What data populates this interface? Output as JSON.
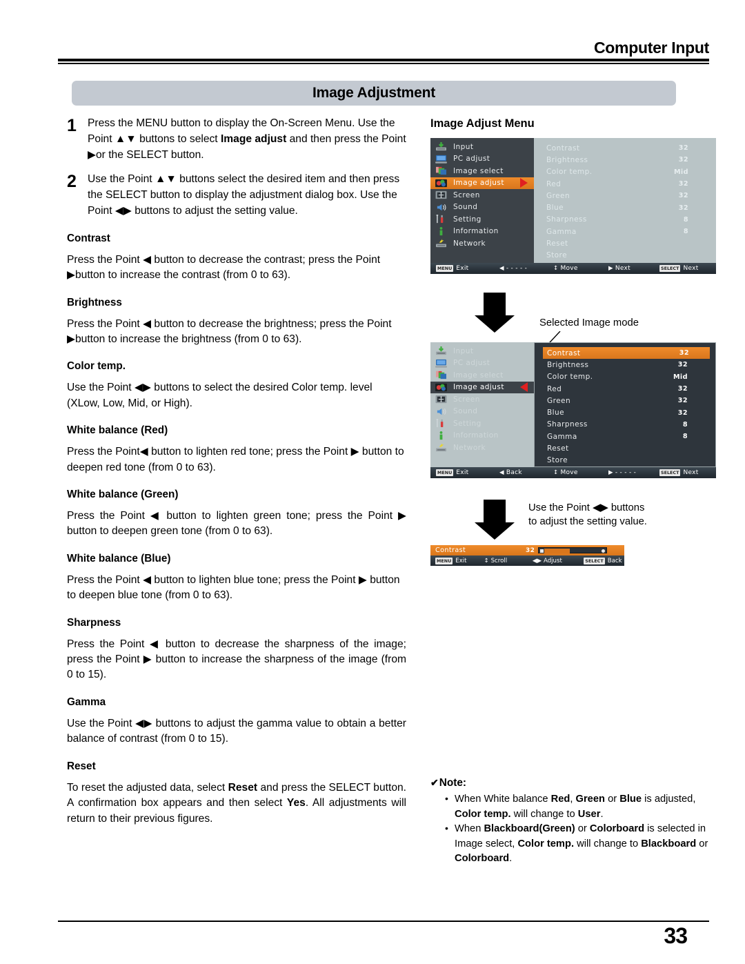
{
  "header": {
    "title": "Computer Input",
    "section": "Image Adjustment"
  },
  "steps": [
    {
      "num": "1",
      "parts": [
        {
          "t": "Press the MENU button to display the On-Screen Menu. Use the Point ▲▼ buttons to select ",
          "b": false
        },
        {
          "t": "Image adjust",
          "b": true
        },
        {
          "t": " and then press the Point ▶or the SELECT button.",
          "b": false
        }
      ]
    },
    {
      "num": "2",
      "parts": [
        {
          "t": "Use the Point ▲▼ buttons select the desired item and then press the SELECT button to display the adjustment dialog box. Use the Point ◀▶ buttons to adjust the setting value.",
          "b": false
        }
      ]
    }
  ],
  "sections": [
    {
      "heading": "Contrast",
      "parts": [
        {
          "t": "Press the Point ◀ button to decrease the contrast; press the Point ▶button to increase the contrast (from 0 to 63).",
          "b": false
        }
      ]
    },
    {
      "heading": "Brightness",
      "parts": [
        {
          "t": "Press the Point ◀ button to decrease the brightness; press the Point ▶button to increase the brightness (from 0 to 63).",
          "b": false
        }
      ]
    },
    {
      "heading": "Color temp.",
      "parts": [
        {
          "t": "Use the Point ◀▶ buttons to select the desired Color temp. level (XLow, Low, Mid, or High).",
          "b": false
        }
      ]
    },
    {
      "heading": "White balance (Red)",
      "parts": [
        {
          "t": "Press the Point◀ button to lighten red tone; press the Point ▶ button to deepen red tone (from 0 to 63).",
          "b": false
        }
      ]
    },
    {
      "heading": "White balance (Green)",
      "parts": [
        {
          "t": "Press the Point ◀ button to lighten green tone; press the Point ▶ button to deepen green tone (from 0 to 63).",
          "b": false
        }
      ]
    },
    {
      "heading": "White balance (Blue)",
      "parts": [
        {
          "t": "Press the Point ◀ button to lighten blue tone; press the Point ▶ button to deepen blue tone (from 0 to 63).",
          "b": false
        }
      ]
    },
    {
      "heading": "Sharpness",
      "parts": [
        {
          "t": "Press the Point ◀ button to decrease the sharpness of the image; press the Point ▶ button to increase the sharpness of the image (from 0 to 15).",
          "b": false
        }
      ]
    },
    {
      "heading": "Gamma",
      "parts": [
        {
          "t": "Use the Point ◀▶ buttons to adjust the gamma value to obtain a better balance of contrast (from 0 to 15).",
          "b": false
        }
      ]
    },
    {
      "heading": "Reset",
      "parts": [
        {
          "t": "To reset the adjusted data, select ",
          "b": false
        },
        {
          "t": "Reset",
          "b": true
        },
        {
          "t": " and press the SELECT button. A confirmation box appears and then select ",
          "b": false
        },
        {
          "t": "Yes",
          "b": true
        },
        {
          "t": ". All adjustments will return to their previous figures.",
          "b": false
        }
      ]
    }
  ],
  "right": {
    "title": "Image Adjust Menu",
    "callout_selected_mode": "Selected Image mode",
    "callout_adjust": "Use the Point ◀▶ buttons to adjust the setting value."
  },
  "osd_menu_items": [
    {
      "label": "Input",
      "icon": "input-icon"
    },
    {
      "label": "PC adjust",
      "icon": "pc-adjust-icon"
    },
    {
      "label": "Image select",
      "icon": "image-select-icon"
    },
    {
      "label": "Image adjust",
      "icon": "image-adjust-icon"
    },
    {
      "label": "Screen",
      "icon": "screen-icon"
    },
    {
      "label": "Sound",
      "icon": "sound-icon"
    },
    {
      "label": "Setting",
      "icon": "setting-icon"
    },
    {
      "label": "Information",
      "icon": "information-icon"
    },
    {
      "label": "Network",
      "icon": "network-icon"
    }
  ],
  "osd_selected_index": 3,
  "osd_values": [
    {
      "name": "Contrast",
      "value": "32"
    },
    {
      "name": "Brightness",
      "value": "32"
    },
    {
      "name": "Color temp.",
      "value": "Mid"
    },
    {
      "name": "Red",
      "value": "32"
    },
    {
      "name": "Green",
      "value": "32"
    },
    {
      "name": "Blue",
      "value": "32"
    },
    {
      "name": "Sharpness",
      "value": "8"
    },
    {
      "name": "Gamma",
      "value": "8"
    },
    {
      "name": "Reset",
      "value": ""
    },
    {
      "name": "Store",
      "value": ""
    }
  ],
  "osd1_status": [
    {
      "key": "MENU",
      "glyph": "",
      "label": "Exit"
    },
    {
      "key": "",
      "glyph": "◀",
      "label": "- - - - -"
    },
    {
      "key": "",
      "glyph": "↕",
      "label": "Move"
    },
    {
      "key": "",
      "glyph": "▶",
      "label": "Next"
    },
    {
      "key": "SELECT",
      "glyph": "",
      "label": "Next"
    }
  ],
  "osd2_status": [
    {
      "key": "MENU",
      "glyph": "",
      "label": "Exit"
    },
    {
      "key": "",
      "glyph": "◀",
      "label": "Back"
    },
    {
      "key": "",
      "glyph": "↕",
      "label": "Move"
    },
    {
      "key": "",
      "glyph": "▶",
      "label": "- - - - -"
    },
    {
      "key": "SELECT",
      "glyph": "",
      "label": "Next"
    }
  ],
  "slider_dialog": {
    "name": "Contrast",
    "value": "32",
    "status": [
      {
        "key": "MENU",
        "glyph": "",
        "label": "Exit"
      },
      {
        "key": "",
        "glyph": "↕",
        "label": "Scroll"
      },
      {
        "key": "",
        "glyph": "◀▶",
        "label": "Adjust"
      },
      {
        "key": "SELECT",
        "glyph": "",
        "label": "Back"
      }
    ]
  },
  "note": {
    "title": "Note:",
    "check": "✔",
    "items": [
      [
        {
          "t": "When White balance ",
          "b": false
        },
        {
          "t": "Red",
          "b": true
        },
        {
          "t": ", ",
          "b": false
        },
        {
          "t": "Green",
          "b": true
        },
        {
          "t": " or ",
          "b": false
        },
        {
          "t": "Blue",
          "b": true
        },
        {
          "t": " is adjusted, ",
          "b": false
        },
        {
          "t": "Color temp.",
          "b": true
        },
        {
          "t": " will change to ",
          "b": false
        },
        {
          "t": "User",
          "b": true
        },
        {
          "t": ".",
          "b": false
        }
      ],
      [
        {
          "t": "When ",
          "b": false
        },
        {
          "t": "Blackboard(Green)",
          "b": true
        },
        {
          "t": " or ",
          "b": false
        },
        {
          "t": "Colorboard",
          "b": true
        },
        {
          "t": " is selected in Image select, ",
          "b": false
        },
        {
          "t": "Color temp.",
          "b": true
        },
        {
          "t": " will change to ",
          "b": false
        },
        {
          "t": "Blackboard",
          "b": true
        },
        {
          "t": " or ",
          "b": false
        },
        {
          "t": "Colorboard",
          "b": true
        },
        {
          "t": ".",
          "b": false
        }
      ]
    ]
  },
  "footer": {
    "page_number": "33"
  },
  "colors": {
    "accent_orange": "#d9761c",
    "banner_gray": "#c3c9d1",
    "osd_dark": "#3c4248",
    "osd_light": "#b9c4c6",
    "osd_panel_dark": "#2e353c",
    "arrow_red": "#e02020"
  }
}
